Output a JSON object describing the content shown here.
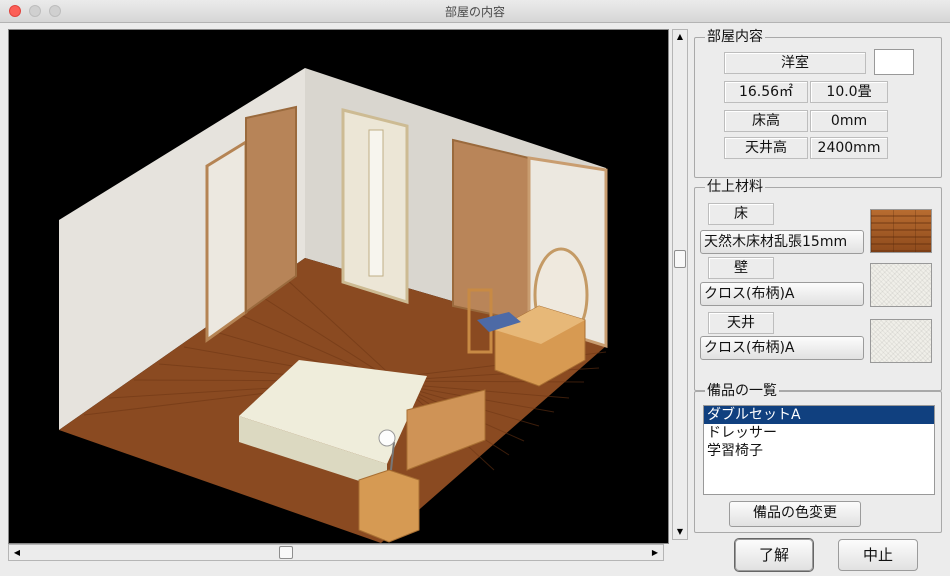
{
  "window": {
    "title": "部屋の内容"
  },
  "room": {
    "legend": "部屋内容",
    "type": "洋室",
    "color": "#ffffff",
    "area": "16.56㎡",
    "tatami": "10.0畳",
    "floor_height_label": "床高",
    "floor_height_value": "0mm",
    "ceiling_height_label": "天井高",
    "ceiling_height_value": "2400mm"
  },
  "materials": {
    "legend": "仕上材料",
    "floor": {
      "label": "床",
      "value": "天然木床材乱張15mm",
      "swatch": "wood"
    },
    "wall": {
      "label": "壁",
      "value": "クロス(布柄)A",
      "swatch": "cloth"
    },
    "ceiling": {
      "label": "天井",
      "value": "クロス(布柄)A",
      "swatch": "cloth"
    }
  },
  "equipment": {
    "legend": "備品の一覧",
    "items": [
      "ダブルセットA",
      "ドレッサー",
      "学習椅子"
    ],
    "selected_index": 0,
    "change_color_label": "備品の色変更"
  },
  "footer": {
    "ok_label": "了解",
    "cancel_label": "中止"
  },
  "colors": {
    "selection": "#10407f",
    "viewport_bg": "#000000"
  }
}
